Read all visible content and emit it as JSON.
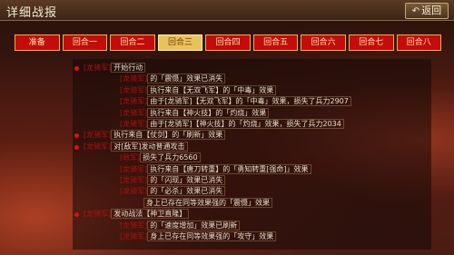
{
  "header": {
    "title": "详细战报",
    "back_label": "返回",
    "back_icon": "return-arrow-icon"
  },
  "tabs": [
    "准备",
    "回合一",
    "回合二",
    "回合三",
    "回合四",
    "回合五",
    "回合六",
    "回合七",
    "回合八"
  ],
  "active_tab": 3,
  "log": [
    {
      "type": "main",
      "tag": "[龙骑军]",
      "text": "开始行动"
    },
    {
      "type": "sub",
      "tag": "[龙骑军]",
      "text": "的「震慑」效果已消失"
    },
    {
      "type": "sub",
      "tag": "[龙骑军]",
      "text": "执行来自【无双飞军】的「中毒」效果"
    },
    {
      "type": "sub",
      "tag": "[龙骑军]",
      "text": "由于[龙骑军]【无双飞军】的「中毒」效果，损失了兵力2907"
    },
    {
      "type": "sub",
      "tag": "[龙骑军]",
      "text": "执行来自【神火技】的「灼烧」效果"
    },
    {
      "type": "sub",
      "tag": "[龙骑军]",
      "text": "由于[龙骑军]【神火技】的「灼烧」效果，损失了兵力2034"
    },
    {
      "type": "main",
      "tag": "[龙骑军]",
      "text": "执行来自【仗剑】的「刷新」效果"
    },
    {
      "type": "main",
      "tag": "[龙骑军]",
      "text": "对[敌军]发动普通攻击"
    },
    {
      "type": "sub",
      "tag": "[敌军]",
      "text": "损失了兵力6560"
    },
    {
      "type": "sub",
      "tag": "[龙骑军]",
      "text": "执行来自【唐刀转重】的「勇知转重[强命]」效果"
    },
    {
      "type": "sub",
      "tag": "[龙骑军]",
      "text": "的「闪现」效果已消失"
    },
    {
      "type": "sub",
      "tag": "[龙骑军]",
      "text": "的「必杀」效果已消失"
    },
    {
      "type": "subsub",
      "tag": "",
      "text": "身上已存在同等效果强的「震慑」效果"
    },
    {
      "type": "main",
      "tag": "[龙骑军]",
      "text": "发动战法【神卫直隆】"
    },
    {
      "type": "sub",
      "tag": "[龙骑军]",
      "text": "的「速度增加」效果已刷新"
    },
    {
      "type": "sub",
      "tag": "[龙骑军]",
      "text": "身上已存在同等效果强的「攻守」效果"
    }
  ],
  "colors": {
    "tab_bg": "#c40c0c",
    "tab_active": "#e8c35a",
    "tag_red": "#b01010"
  }
}
